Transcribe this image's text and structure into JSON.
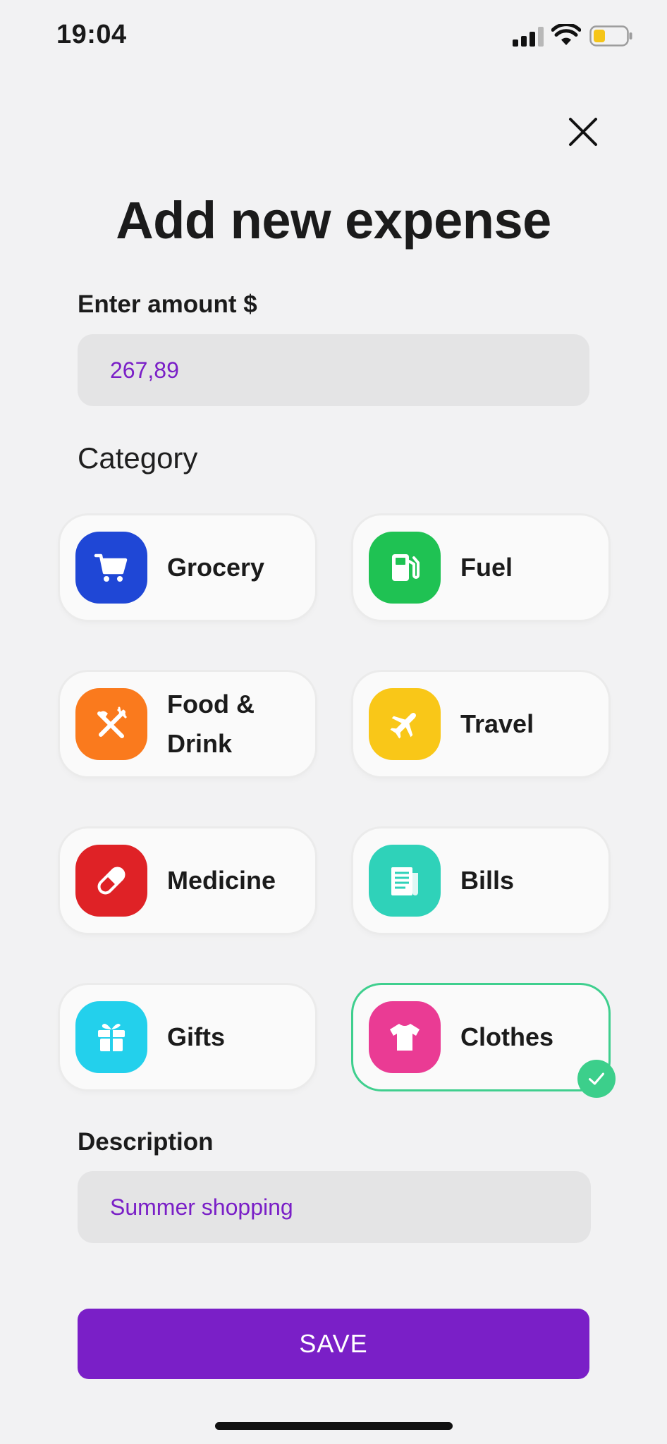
{
  "status_bar": {
    "time": "19:04",
    "battery_color": "#f5c518"
  },
  "header": {
    "title": "Add new expense",
    "close_icon": "close-icon"
  },
  "amount": {
    "label": "Enter amount $",
    "value": "267,89"
  },
  "category": {
    "title": "Category",
    "selected": "Clothes",
    "items": [
      {
        "label": "Grocery",
        "icon": "cart-icon",
        "color": "#1f47d6"
      },
      {
        "label": "Fuel",
        "icon": "fuel-pump-icon",
        "color": "#1fc253"
      },
      {
        "label": "Food & Drink",
        "icon": "fork-knife-icon",
        "color": "#fa7a1d"
      },
      {
        "label": "Travel",
        "icon": "airplane-icon",
        "color": "#f9c718"
      },
      {
        "label": "Medicine",
        "icon": "pill-icon",
        "color": "#df2226"
      },
      {
        "label": "Bills",
        "icon": "receipt-icon",
        "color": "#2fd2b9"
      },
      {
        "label": "Gifts",
        "icon": "gift-icon",
        "color": "#23d0ec"
      },
      {
        "label": "Clothes",
        "icon": "tshirt-icon",
        "color": "#ea3b94"
      }
    ]
  },
  "description": {
    "label": "Description",
    "value": "Summer shopping"
  },
  "save_label": "SAVE",
  "colors": {
    "accent": "#7a1fc7",
    "selected_border": "#3fcf8e",
    "background": "#f2f2f3"
  }
}
